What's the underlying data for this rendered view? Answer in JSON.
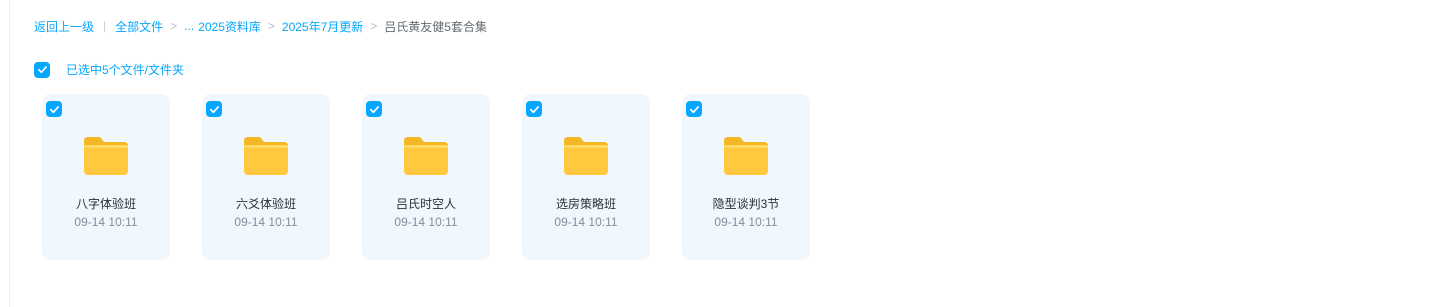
{
  "breadcrumb": {
    "back": "返回上一级",
    "items": [
      "全部文件",
      "...",
      "2025资料库",
      "2025年7月更新"
    ],
    "current": "吕氏黄友健5套合集",
    "separator": ">",
    "pipe": "|"
  },
  "selection": {
    "label": "已选中5个文件/文件夹",
    "checked": true
  },
  "files": [
    {
      "name": "八字体验班",
      "time": "09-14 10:11",
      "type": "folder",
      "selected": true
    },
    {
      "name": "六爻体验班",
      "time": "09-14 10:11",
      "type": "folder",
      "selected": true
    },
    {
      "name": "吕氏时空人",
      "time": "09-14 10:11",
      "type": "folder",
      "selected": true
    },
    {
      "name": "选房策略班",
      "time": "09-14 10:11",
      "type": "folder",
      "selected": true
    },
    {
      "name": "隐型谈判3节",
      "time": "09-14 10:11",
      "type": "folder",
      "selected": true
    }
  ],
  "colors": {
    "accent": "#06a7ff",
    "card_bg": "#f0f7fd",
    "folder": "#ffc83d"
  },
  "icons": {
    "check": "checkmark-icon",
    "folder": "folder-icon"
  }
}
